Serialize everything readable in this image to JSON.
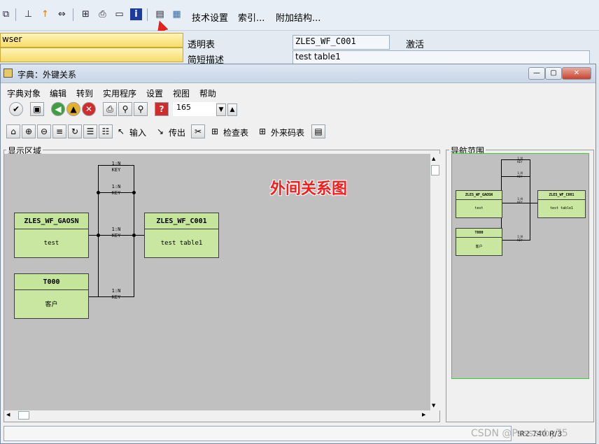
{
  "app_toolbar": {
    "menu": [
      "技术设置",
      "索引...",
      "附加结构..."
    ],
    "icons": [
      "other-object-icon",
      "hierarchy-icon",
      "where-used-icon",
      "navigate-icon",
      "tree-icon",
      "print-icon",
      "display-icon",
      "info-icon",
      "graphic-icon",
      "table-icon"
    ]
  },
  "form": {
    "left_field_1": "wser",
    "left_field_2": "",
    "rows": [
      {
        "label": "透明表",
        "value": "ZLES_WF_C001",
        "status": "激活"
      },
      {
        "label": "简短描述",
        "value": "test table1"
      }
    ]
  },
  "dialog": {
    "title": "字典：外键关系",
    "menu": [
      "字典对象",
      "编辑",
      "转到",
      "实用程序",
      "设置",
      "视图",
      "帮助"
    ],
    "zoom_value": "165",
    "toolbar2_labels": {
      "input": "输入",
      "output": "传出",
      "check_table": "检查表",
      "foreign_key_table": "外来码表"
    },
    "display_area_label": "显示区域",
    "nav_area_label": "导航范围",
    "annotation": "外间关系图"
  },
  "diagram": {
    "nodes": [
      {
        "name": "ZLES_WF_GAOSN",
        "desc": "test"
      },
      {
        "name": "ZLES_WF_C001",
        "desc": "test table1"
      },
      {
        "name": "T000",
        "desc": "客户"
      }
    ],
    "relations": [
      {
        "card": "1:N",
        "key": "KEY"
      },
      {
        "card": "1:N",
        "key": "KEY"
      },
      {
        "card": "1:N",
        "key": "KEY"
      },
      {
        "card": "1:N",
        "key": "KEY"
      }
    ]
  },
  "statusbar": {
    "text": "CSDN @Passerby75",
    "partial": "IR2  740  R/3"
  },
  "colors": {
    "node_fill": "#c9e7a0",
    "canvas": "#c0c0c0",
    "annotation": "#ff1a1a",
    "nav_border": "#35d035",
    "arrow": "#e8201e"
  }
}
